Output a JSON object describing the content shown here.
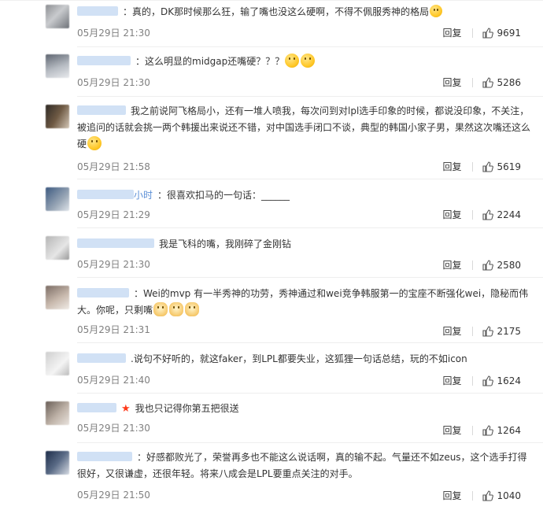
{
  "comments": [
    {
      "text": "真的，DK那时候那么狂，输了嘴也没这么硬啊，不得不佩服秀神的格局",
      "emojis": [
        "smile"
      ],
      "time": "05月29日 21:30",
      "reply": "回复",
      "likes": "9691"
    },
    {
      "text": "这么明显的midgap还嘴硬？？？",
      "emojis": [
        "cry",
        "cry"
      ],
      "time": "05月29日 21:30",
      "reply": "回复",
      "likes": "5286"
    },
    {
      "text": "我之前说阿飞格局小，还有一堆人喷我，每次问到对lpl选手印象的时候，都说没印象，不关注，被追问的话就会挑一两个韩援出来说还不错，对中国选手闭口不谈，典型的韩国小家子男，果然这次嘴还这么硬",
      "emojis": [
        "smile"
      ],
      "time": "05月29日 21:58",
      "reply": "回复",
      "likes": "5619"
    },
    {
      "name_tail": "小时",
      "text": "很喜欢扣马的一句话：______",
      "emojis": [],
      "time": "05月29日 21:29",
      "reply": "回复",
      "likes": "2244"
    },
    {
      "text": "我是飞科的嘴，我刚碎了金刚钻",
      "emojis": [],
      "time": "05月29日 21:30",
      "reply": "回复",
      "likes": "2580"
    },
    {
      "text": "Wei的mvp 有一半秀神的功劳，秀神通过和wei竞争韩服第一的宝座不断强化wei，隐秘而伟大。你呢，只剩嘴",
      "emojis": [
        "doge",
        "doge",
        "doge"
      ],
      "time": "05月29日 21:31",
      "reply": "回复",
      "likes": "2175"
    },
    {
      "text": "说句不好听的，就这faker，到LPL都要失业，这狐狸一句话总结，玩的不如icon",
      "emojis": [],
      "time": "05月29日 21:40",
      "reply": "回复",
      "likes": "1624"
    },
    {
      "text": "我也只记得你第五把很送",
      "emojis": [],
      "vip": "★",
      "time": "05月29日 21:30",
      "reply": "回复",
      "likes": "1264"
    },
    {
      "text": "好感都败光了，荣誉再多也不能这么说话啊，真的输不起。气量还不如zeus，这个选手打得很好，又很谦虚，还很年轻。将来八成会是LPL要重点关注的对手。",
      "emojis": [],
      "time": "05月29日 21:50",
      "reply": "回复",
      "likes": "1040"
    }
  ]
}
